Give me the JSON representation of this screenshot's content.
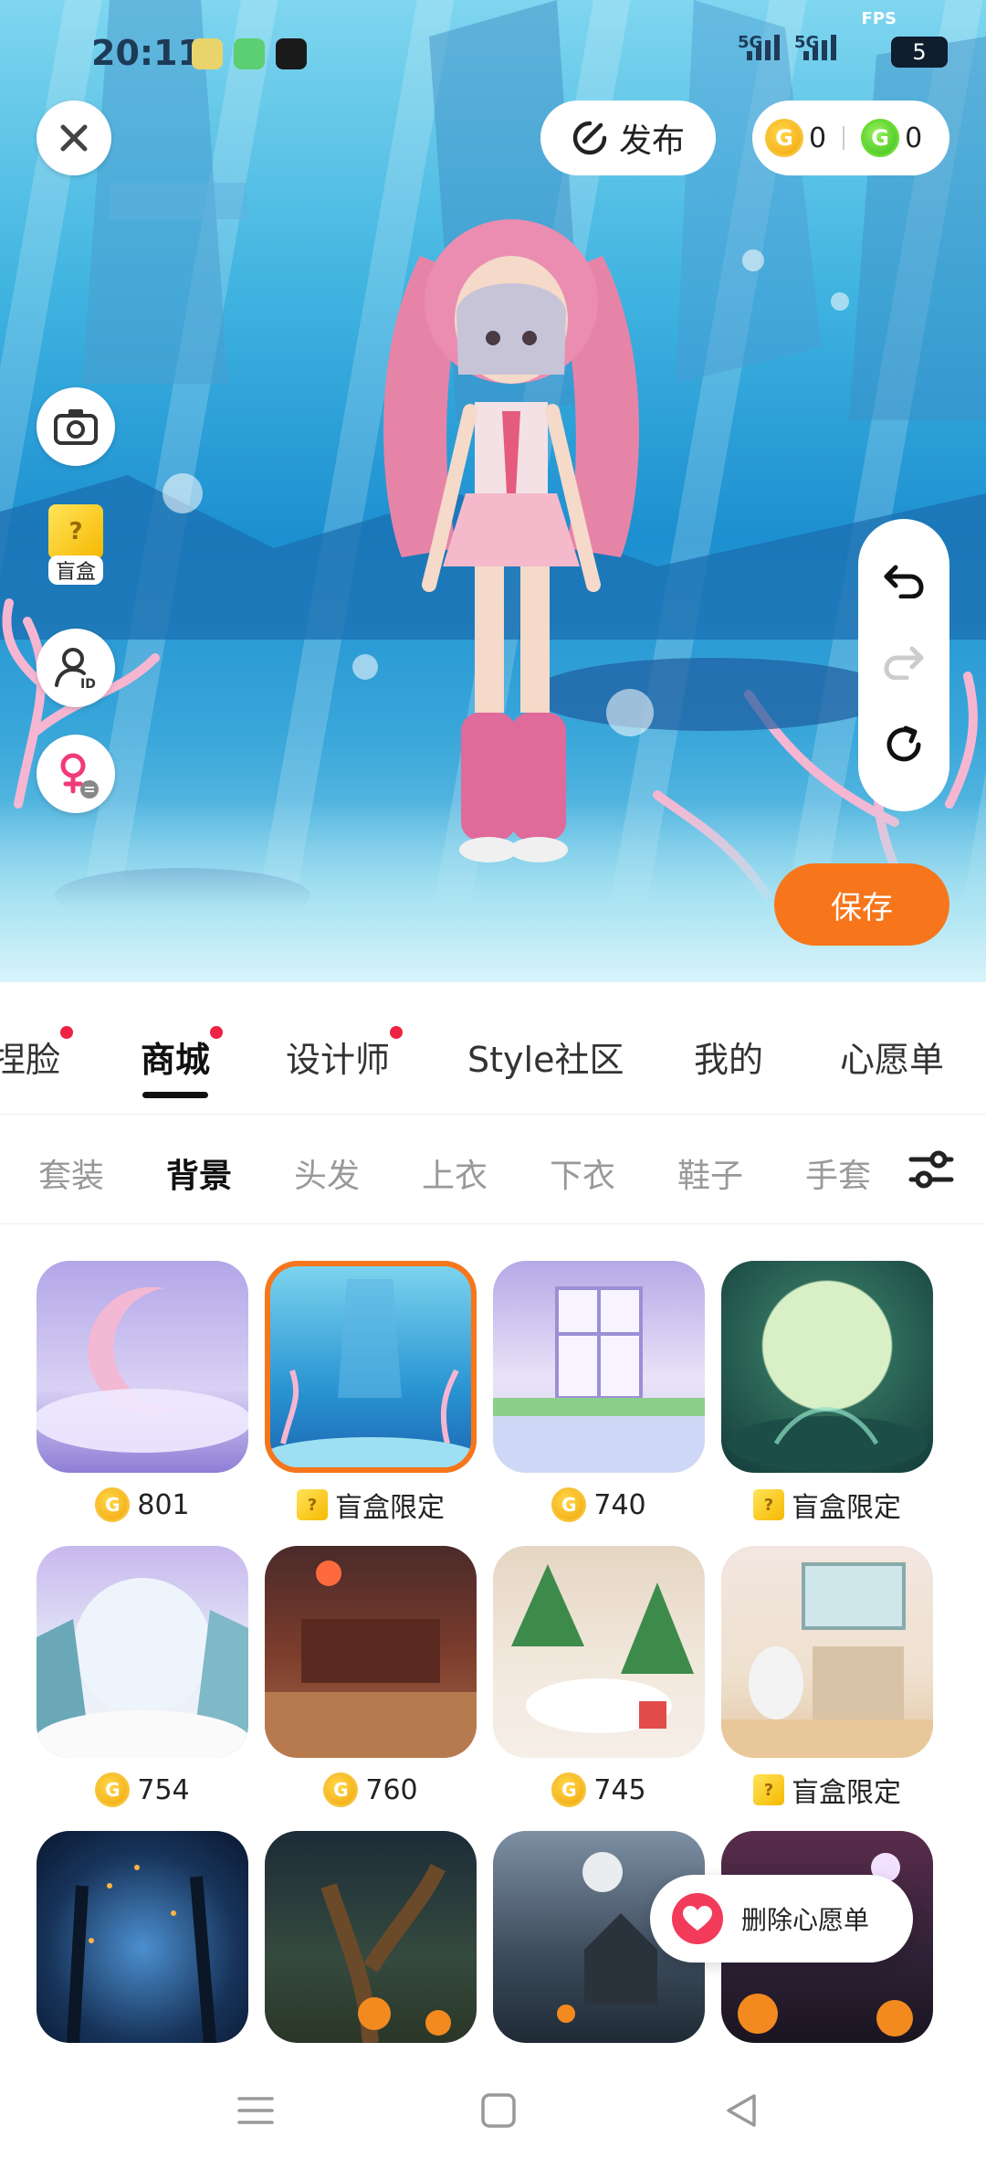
{
  "status": {
    "time": "20:11",
    "fps_label": "FPS",
    "network_1": "5G",
    "network_2": "5G",
    "battery": "5"
  },
  "toolbar": {
    "publish_label": "发布",
    "gold_coins": "0",
    "green_coins": "0"
  },
  "side": {
    "blindbox_label": "盲盒"
  },
  "save_label": "保存",
  "main_tabs": [
    {
      "label": "捏脸",
      "dot": true
    },
    {
      "label": "商城",
      "dot": true,
      "active": true
    },
    {
      "label": "设计师",
      "dot": true
    },
    {
      "label": "Style社区",
      "dot": false
    },
    {
      "label": "我的",
      "dot": false
    },
    {
      "label": "心愿单",
      "dot": false
    }
  ],
  "sub_tabs": [
    {
      "label": "套装"
    },
    {
      "label": "背景",
      "active": true
    },
    {
      "label": "头发"
    },
    {
      "label": "上衣"
    },
    {
      "label": "下衣"
    },
    {
      "label": "鞋子"
    },
    {
      "label": "手套"
    }
  ],
  "items": [
    {
      "price_type": "coin",
      "price": "801",
      "theme": "crescent-moon"
    },
    {
      "price_type": "blindbox",
      "price": "盲盒限定",
      "theme": "underwater",
      "selected": true
    },
    {
      "price_type": "coin",
      "price": "740",
      "theme": "window-garden"
    },
    {
      "price_type": "blindbox",
      "price": "盲盒限定",
      "theme": "green-moon"
    },
    {
      "price_type": "coin",
      "price": "754",
      "theme": "snow-pavilion"
    },
    {
      "price_type": "coin",
      "price": "760",
      "theme": "chinese-room"
    },
    {
      "price_type": "coin",
      "price": "745",
      "theme": "christmas"
    },
    {
      "price_type": "blindbox",
      "price": "盲盒限定",
      "theme": "kitchen"
    },
    {
      "theme": "night-forest"
    },
    {
      "theme": "spooky-tree"
    },
    {
      "theme": "haunted-house"
    },
    {
      "theme": "halloween"
    }
  ],
  "wishlist_popup": {
    "label": "删除心愿单"
  },
  "colors": {
    "accent": "#f7761b",
    "tab_dot": "#ee2244",
    "heart": "#f23a5a"
  }
}
